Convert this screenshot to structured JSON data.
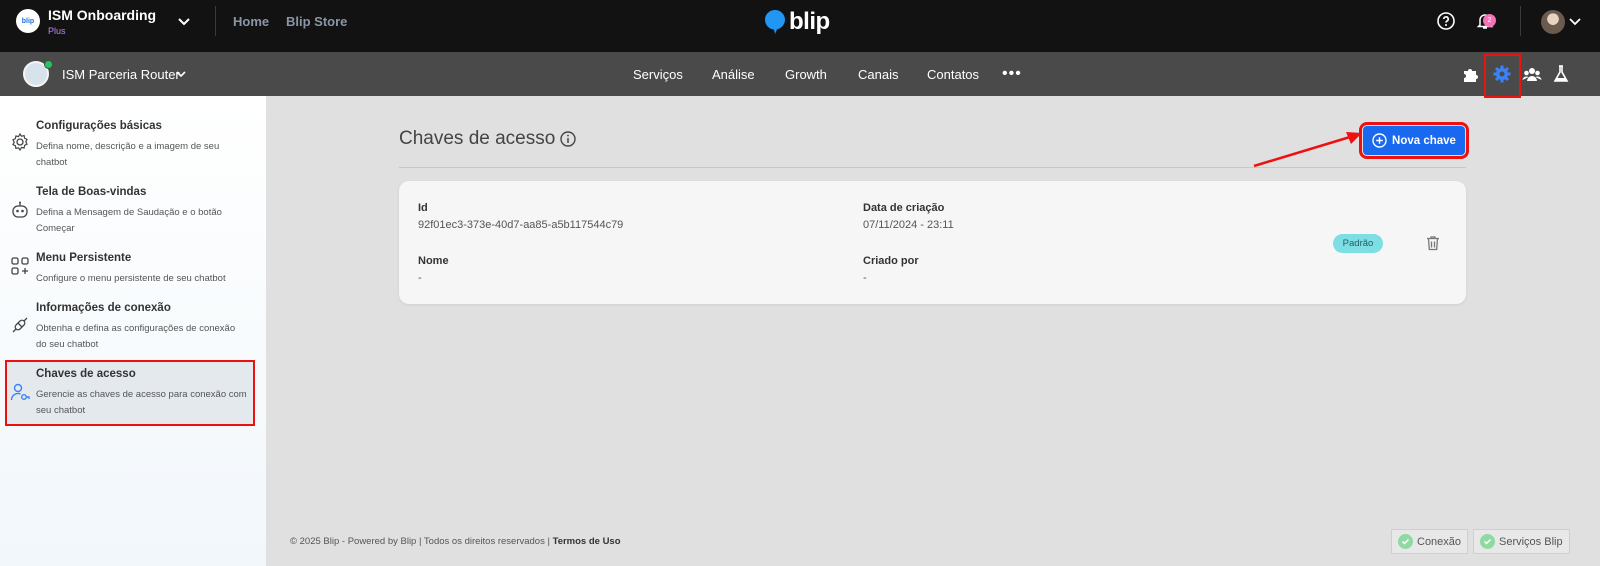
{
  "topbar": {
    "org_logo_text": "blip",
    "org_name": "ISM Onboarding",
    "org_plan": "Plus",
    "links": [
      "Home",
      "Blip Store"
    ],
    "brand": "blip",
    "notification_count": "2"
  },
  "subbar": {
    "bot_name": "ISM Parceria Router",
    "nav": [
      "Serviços",
      "Análise",
      "Growth",
      "Canais",
      "Contatos"
    ],
    "more": "•••",
    "icons": [
      "puzzle-icon",
      "gear-icon",
      "team-icon",
      "flask-icon"
    ]
  },
  "sidebar": {
    "items": [
      {
        "title": "Configurações básicas",
        "desc": "Defina nome, descrição e a imagem de seu chatbot"
      },
      {
        "title": "Tela de Boas-vindas",
        "desc": "Defina a Mensagem de Saudação e o botão Começar"
      },
      {
        "title": "Menu Persistente",
        "desc": "Configure o menu persistente de seu chatbot"
      },
      {
        "title": "Informações de conexão",
        "desc": "Obtenha e defina as configurações de conexão do seu chatbot"
      },
      {
        "title": "Chaves de acesso",
        "desc": "Gerencie as chaves de acesso para conexão com seu chatbot"
      }
    ],
    "active_index": 4
  },
  "main": {
    "title": "Chaves de acesso",
    "new_key_label": "Nova chave",
    "key": {
      "id_label": "Id",
      "id_value": "92f01ec3-373e-40d7-aa85-a5b117544c79",
      "created_label": "Data de criação",
      "created_value": "07/11/2024 - 23:11",
      "name_label": "Nome",
      "name_value": "-",
      "created_by_label": "Criado por",
      "created_by_value": "-",
      "badge": "Padrão"
    }
  },
  "footer": {
    "text": "© 2025 Blip - Powered by Blip | Todos os direitos reservados |",
    "terms": "Termos de Uso",
    "status": [
      "Conexão",
      "Serviços Blip"
    ]
  },
  "colors": {
    "accent": "#1968f0",
    "highlight": "#ef1010",
    "badge": "#7ddfe4",
    "status_ok": "#8fd9a3"
  }
}
